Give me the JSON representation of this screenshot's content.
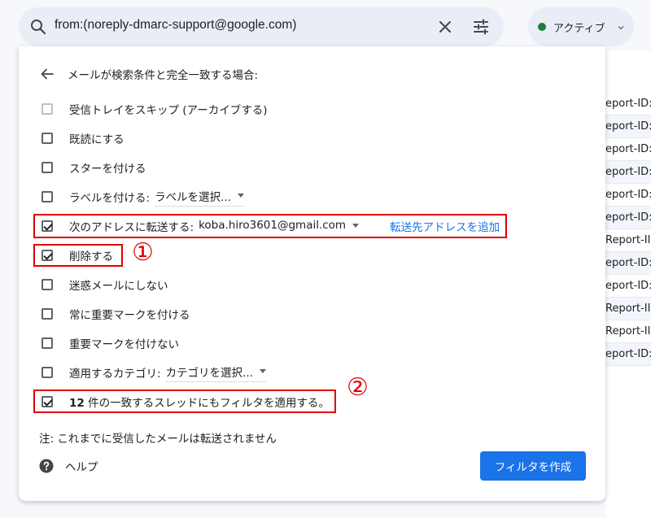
{
  "search": {
    "query": "from:(noreply-dmarc-support@google.com)"
  },
  "status": {
    "label": "アクティブ",
    "dot_color": "#188038"
  },
  "background_rows": [
    "eport-ID:",
    "eport-ID:",
    "eport-ID:",
    "eport-ID:",
    "eport-ID:",
    "eport-ID:",
    "Report-II",
    "eport-ID:",
    "eport-ID:",
    "Report-II",
    "Report-II",
    "eport-ID:"
  ],
  "filter": {
    "heading": "メールが検索条件と完全一致する場合:",
    "options": [
      {
        "label": "受信トレイをスキップ (アーカイブする)",
        "checked": false,
        "disabled": true
      },
      {
        "label": "既読にする",
        "checked": false
      },
      {
        "label": "スターを付ける",
        "checked": false
      },
      {
        "label": "ラベルを付ける:",
        "checked": false,
        "select": "ラベルを選択..."
      },
      {
        "label": "次のアドレスに転送する:",
        "checked": true,
        "select": "koba.hiro3601@gmail.com",
        "link": "転送先アドレスを追加"
      },
      {
        "label": "削除する",
        "checked": true
      },
      {
        "label": "迷惑メールにしない",
        "checked": false
      },
      {
        "label": "常に重要マークを付ける",
        "checked": false
      },
      {
        "label": "重要マークを付けない",
        "checked": false
      },
      {
        "label": "適用するカテゴリ:",
        "checked": false,
        "select": "カテゴリを選択..."
      },
      {
        "label_count": "12",
        "label": " 件の一致するスレッドにもフィルタを適用する。",
        "checked": true
      }
    ],
    "note": "注: これまでに受信したメールは転送されません",
    "help": "ヘルプ",
    "create_button": "フィルタを作成"
  },
  "annotations": {
    "marker_1": "①",
    "marker_2": "②",
    "color": "#e00000"
  }
}
